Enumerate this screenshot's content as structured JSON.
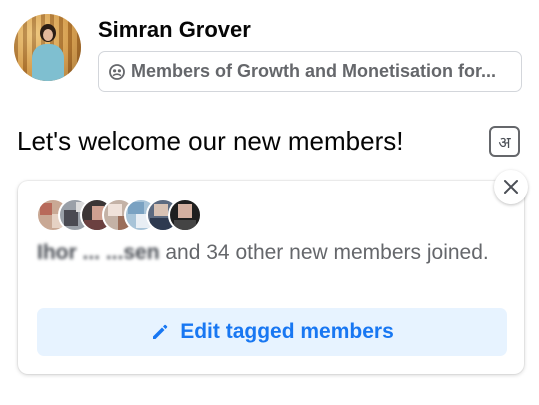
{
  "post": {
    "author_name": "Simran Grover",
    "group_name": "Members of Growth and Monetisation for...",
    "text": "Let's welcome our new members!",
    "translate_glyph": "अ"
  },
  "welcome_card": {
    "tagged_names": "Ihor ... ...sen",
    "joined_suffix": "and 34 other new members joined.",
    "edit_button_label": "Edit tagged members"
  },
  "colors": {
    "accent_blue": "#1877f2",
    "button_bg": "#e7f3ff",
    "secondary_text": "#65676b"
  }
}
